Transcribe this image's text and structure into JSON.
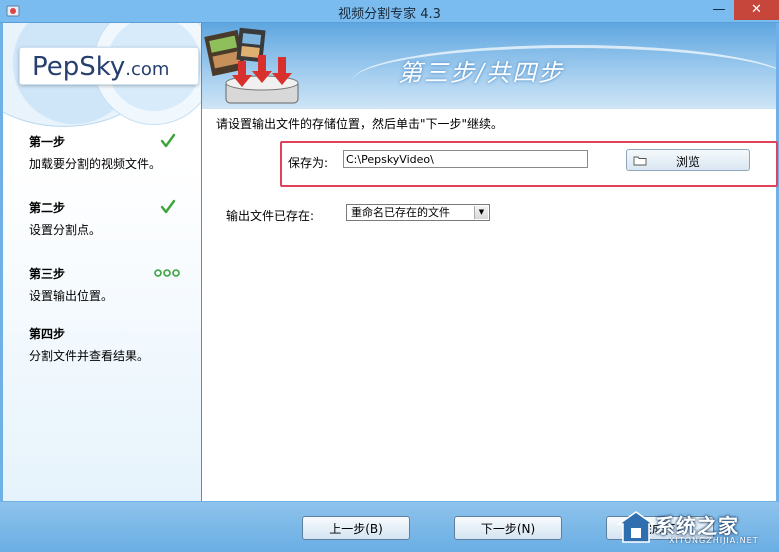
{
  "window": {
    "title": "视频分割专家 4.3",
    "minimize": "—",
    "close": "✕"
  },
  "sidebar": {
    "logo_main": "PepSky",
    "logo_suffix": ".com",
    "steps": [
      {
        "title": "第一步",
        "desc": "加载要分割的视频文件。",
        "status": "done"
      },
      {
        "title": "第二步",
        "desc": "设置分割点。",
        "status": "done"
      },
      {
        "title": "第三步",
        "desc": "设置输出位置。",
        "status": "current"
      },
      {
        "title": "第四步",
        "desc": "分割文件并查看结果。",
        "status": "pending"
      }
    ]
  },
  "main": {
    "heading": "第三步/共四步",
    "instruction": "请设置输出文件的存储位置，然后单击\"下一步\"继续。",
    "save_as_label": "保存为:",
    "save_path": "C:\\PepskyVideo\\",
    "browse_label": "浏览",
    "exists_label": "输出文件已存在:",
    "exists_option": "重命名已存在的文件"
  },
  "footer": {
    "prev_label": "上一步(B)",
    "next_label": "下一步(N)",
    "finish_label": "完成(F)"
  },
  "watermark": {
    "text": "系统之家",
    "url": "XITONGZHIJIA.NET"
  },
  "colors": {
    "accent": "#6fb0e6",
    "highlight": "#e0415b",
    "check": "#3aa53a"
  }
}
